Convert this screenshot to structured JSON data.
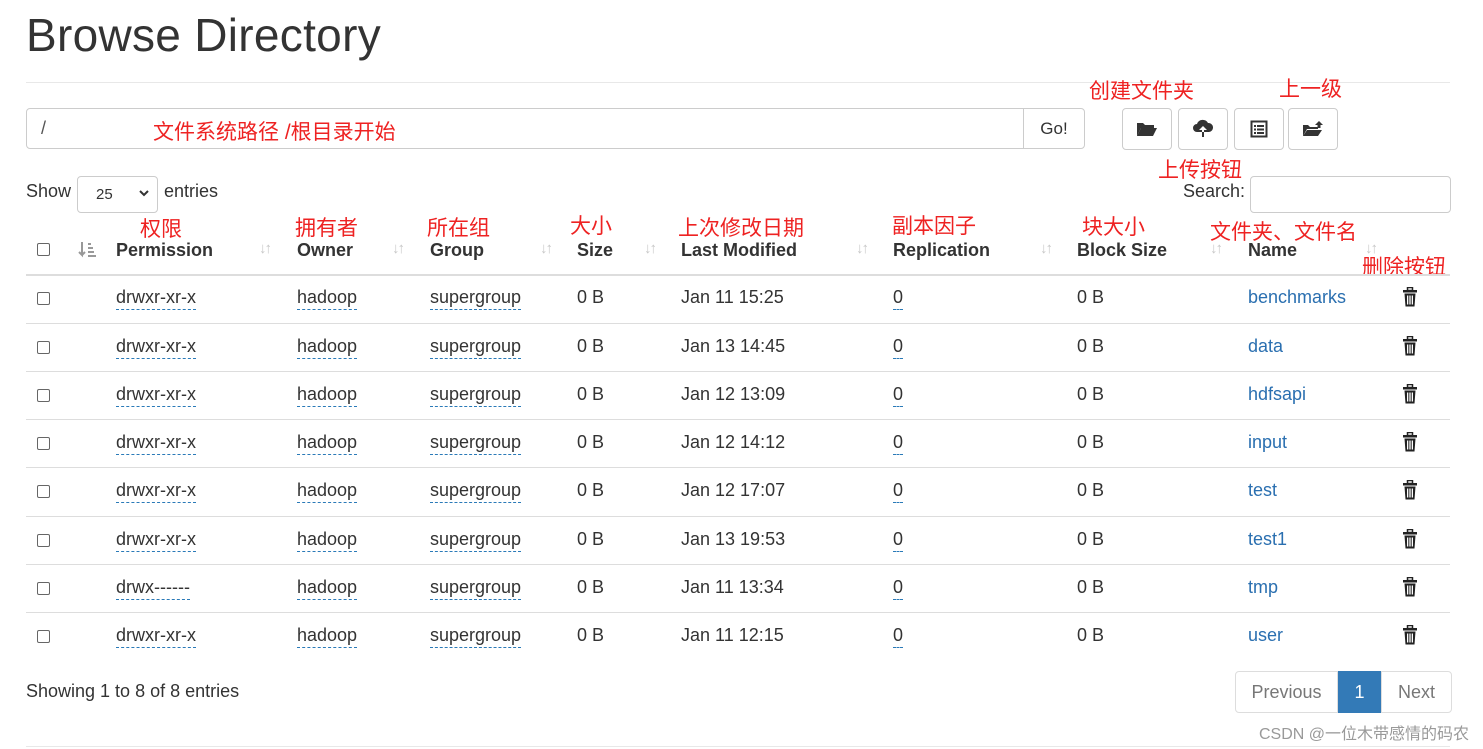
{
  "page": {
    "title": "Browse Directory",
    "path_value": "/",
    "go_label": "Go!",
    "show_label": "Show",
    "page_length": "25",
    "entries_label": "entries",
    "search_label": "Search:",
    "footer_info": "Showing 1 to 8 of 8 entries",
    "pagination": {
      "previous": "Previous",
      "current": "1",
      "next": "Next"
    },
    "watermark": "CSDN @一位木带感情的码农"
  },
  "toolbar_icons": [
    "folder-open-icon",
    "cloud-upload-icon",
    "list-alt-icon",
    "folder-up-icon"
  ],
  "annotations": {
    "path": "文件系统路径 /根目录开始",
    "mkdir": "创建文件夹",
    "up": "上一级",
    "upload": "上传按钮",
    "permission": "权限",
    "owner": "拥有者",
    "group": "所在组",
    "size": "大小",
    "last_modified": "上次修改日期",
    "replication": "副本因子",
    "block_size": "块大小",
    "name": "文件夹、文件名",
    "delete": "删除按钮"
  },
  "columns": {
    "permission": "Permission",
    "owner": "Owner",
    "group": "Group",
    "size": "Size",
    "last_modified": "Last Modified",
    "replication": "Replication",
    "block_size": "Block Size",
    "name": "Name"
  },
  "rows": [
    {
      "permission": "drwxr-xr-x",
      "owner": "hadoop",
      "group": "supergroup",
      "size": "0 B",
      "last_modified": "Jan 11 15:25",
      "replication": "0",
      "block_size": "0 B",
      "name": "benchmarks"
    },
    {
      "permission": "drwxr-xr-x",
      "owner": "hadoop",
      "group": "supergroup",
      "size": "0 B",
      "last_modified": "Jan 13 14:45",
      "replication": "0",
      "block_size": "0 B",
      "name": "data"
    },
    {
      "permission": "drwxr-xr-x",
      "owner": "hadoop",
      "group": "supergroup",
      "size": "0 B",
      "last_modified": "Jan 12 13:09",
      "replication": "0",
      "block_size": "0 B",
      "name": "hdfsapi"
    },
    {
      "permission": "drwxr-xr-x",
      "owner": "hadoop",
      "group": "supergroup",
      "size": "0 B",
      "last_modified": "Jan 12 14:12",
      "replication": "0",
      "block_size": "0 B",
      "name": "input"
    },
    {
      "permission": "drwxr-xr-x",
      "owner": "hadoop",
      "group": "supergroup",
      "size": "0 B",
      "last_modified": "Jan 12 17:07",
      "replication": "0",
      "block_size": "0 B",
      "name": "test"
    },
    {
      "permission": "drwxr-xr-x",
      "owner": "hadoop",
      "group": "supergroup",
      "size": "0 B",
      "last_modified": "Jan 13 19:53",
      "replication": "0",
      "block_size": "0 B",
      "name": "test1"
    },
    {
      "permission": "drwx------",
      "owner": "hadoop",
      "group": "supergroup",
      "size": "0 B",
      "last_modified": "Jan 11 13:34",
      "replication": "0",
      "block_size": "0 B",
      "name": "tmp"
    },
    {
      "permission": "drwxr-xr-x",
      "owner": "hadoop",
      "group": "supergroup",
      "size": "0 B",
      "last_modified": "Jan 11 12:15",
      "replication": "0",
      "block_size": "0 B",
      "name": "user"
    }
  ],
  "colors": {
    "accent": "#337ab7",
    "link": "#2a6fb0",
    "annotation": "#ee2222"
  }
}
